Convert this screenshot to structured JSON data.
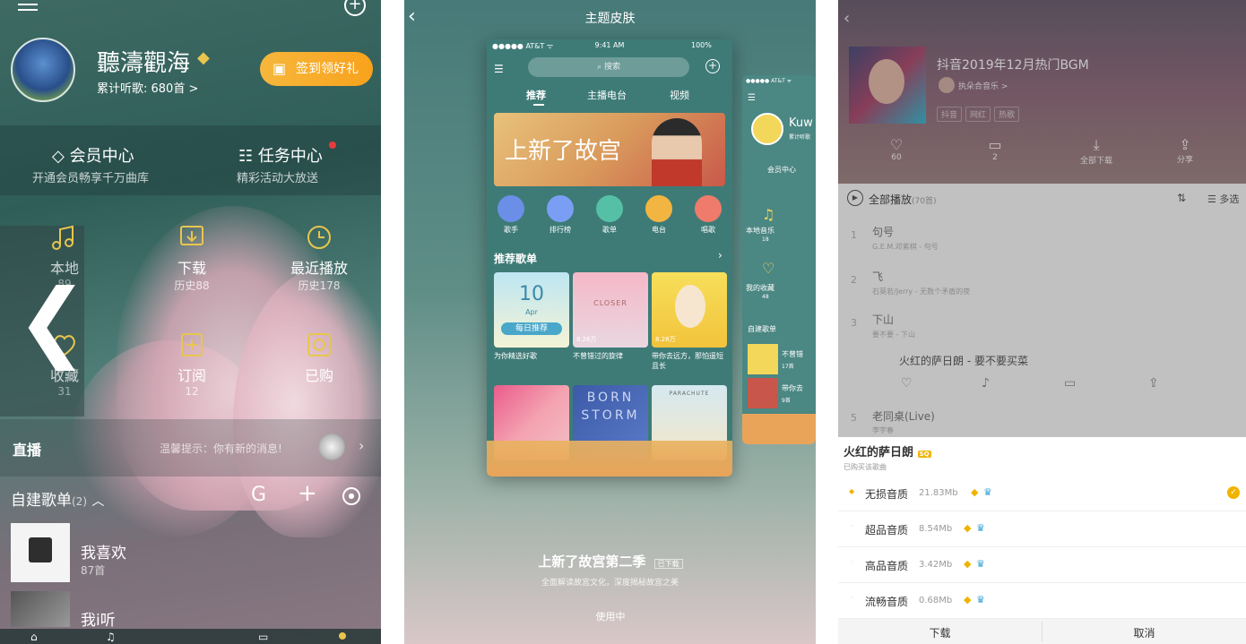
{
  "p1": {
    "username": "聽濤觀海",
    "listen_count": "累计听歌: 680首 >",
    "signin_button": "签到领好礼",
    "vip_center": "会员中心",
    "vip_sub": "开通会员畅享千万曲库",
    "task_center": "任务中心",
    "task_sub": "精彩活动大放送",
    "local_label": "本地",
    "local_count": "89",
    "download_label": "下载",
    "download_sub": "历史88",
    "recent_label": "最近播放",
    "recent_sub": "历史178",
    "fav_label": "收藏",
    "fav_count": "31",
    "subscribe_label": "订阅",
    "subscribe_count": "12",
    "bought_label": "已购",
    "live_label": "直播",
    "live_message": "温馨提示：你有新的消息!",
    "playlist_header": "自建歌单",
    "playlist_count": "(2)",
    "playlists": [
      {
        "name": "我喜欢",
        "count": "87首"
      },
      {
        "name": "我i听",
        "count": ""
      }
    ],
    "accent": "#e8c64d"
  },
  "p2": {
    "title": "主题皮肤",
    "status_left": "●●●●● AT&T ᯤ",
    "status_time": "9:41 AM",
    "status_right": "100%",
    "search_placeholder": "搜索",
    "tabs": [
      "推荐",
      "主播电台",
      "视频"
    ],
    "banner_text": "上新了故宫",
    "categories": [
      "歌手",
      "排行榜",
      "歌单",
      "电台",
      "唱歌"
    ],
    "section_title": "推荐歌单",
    "cards": [
      {
        "title": "为你精选好歌",
        "badge": "每日推荐",
        "date_day": "10",
        "date_month": "Apr"
      },
      {
        "title": "不曾错过的旋律",
        "badge": "CLOSER",
        "plays": "8.26万"
      },
      {
        "title": "带你去远方，那怕遥短且长",
        "badge": "",
        "plays": "8.28万"
      }
    ],
    "second_row": [
      "BORN",
      "STORM",
      "PARACHUTE"
    ],
    "side_name": "Kuw",
    "side_sub": "累计听歌",
    "side_vip": "会员中心",
    "side_local": "本地音乐",
    "side_local_count": "18",
    "side_fav": "我的收藏",
    "side_fav_count": "48",
    "side_playlist": "自建歌单",
    "side_song1": "不曾错",
    "side_song1_count": "17首",
    "side_song2": "带你去",
    "side_song2_count": "9首",
    "theme_name": "上新了故宫第二季",
    "theme_badge": "已下载",
    "theme_desc": "全面解读故宫文化，深度揭秘故宫之美",
    "use_button": "使用中"
  },
  "p3": {
    "playlist_title": "抖音2019年12月热门BGM",
    "creator": "执朵合音乐 >",
    "tags": [
      "抖音",
      "网红",
      "热歌"
    ],
    "stats": [
      {
        "icon": "heart-icon",
        "value": "60"
      },
      {
        "icon": "comment-icon",
        "value": "2"
      },
      {
        "icon": "download-icon",
        "value": "全部下载"
      },
      {
        "icon": "share-icon",
        "value": "分享"
      }
    ],
    "play_all": "全部播放",
    "play_all_count": "(70首)",
    "multi_select": "多选",
    "songs": [
      {
        "no": "1",
        "title": "句号",
        "artist": "G.E.M.邓紫棋 - 句号"
      },
      {
        "no": "2",
        "title": "飞",
        "artist": "石莫若/Jerry - 无数个矛盾的夜"
      },
      {
        "no": "3",
        "title": "下山",
        "artist": "要不要 - 下山"
      },
      {
        "no": "",
        "title": "火红的萨日朗 - 要不要买菜",
        "artist": ""
      },
      {
        "no": "5",
        "title": "老同桌(Live)",
        "artist": "李宇春"
      }
    ],
    "sheet_title": "火红的萨日朗",
    "sheet_badge": "SQ",
    "sheet_sub": "已购买该歌曲",
    "qualities": [
      {
        "name": "无损音质",
        "size": "21.83Mb",
        "selected": true
      },
      {
        "name": "超品音质",
        "size": "8.54Mb",
        "selected": false
      },
      {
        "name": "高品音质",
        "size": "3.42Mb",
        "selected": false
      },
      {
        "name": "流畅音质",
        "size": "0.68Mb",
        "selected": false
      }
    ],
    "download_button": "下载",
    "cancel_button": "取消",
    "accent": "#f0b400"
  }
}
